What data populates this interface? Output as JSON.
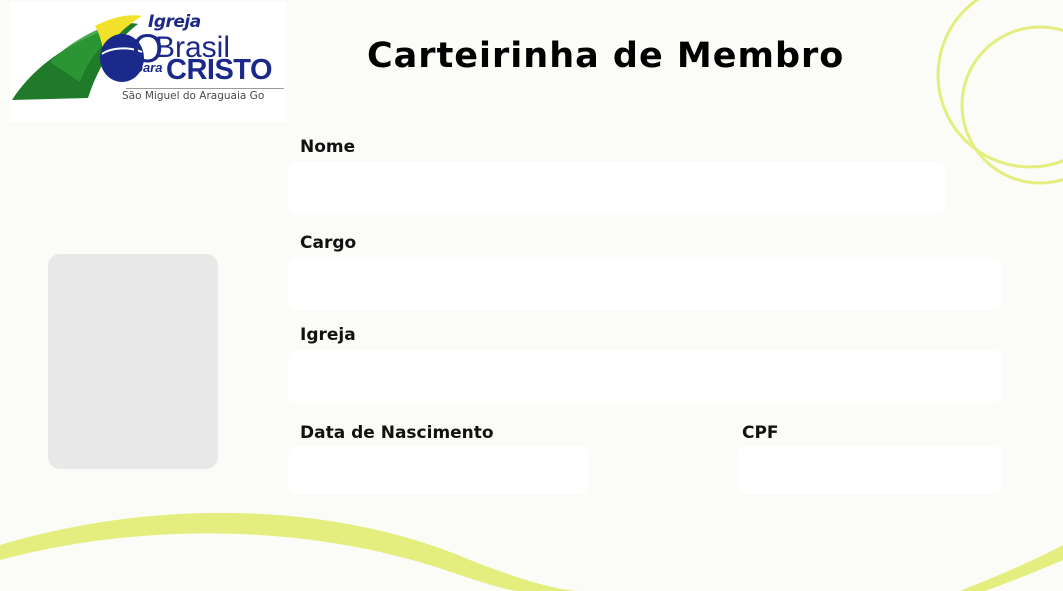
{
  "logo": {
    "igreja": "Igreja",
    "o": "O",
    "brasil": "Brasil",
    "para": "para",
    "cristo": "CRISTO",
    "city": "São Miguel do Araguaia Go"
  },
  "card": {
    "title": "Carteirinha de Membro"
  },
  "fields": {
    "nome": {
      "label": "Nome",
      "value": ""
    },
    "cargo": {
      "label": "Cargo",
      "value": ""
    },
    "igreja": {
      "label": "Igreja",
      "value": ""
    },
    "nascimento": {
      "label": "Data de Nascimento",
      "value": ""
    },
    "cpf": {
      "label": "CPF",
      "value": ""
    }
  },
  "colors": {
    "background": "#fbfbf8",
    "accent": "#e3ee7e",
    "logo_blue": "#1b2a8a",
    "logo_green": "#1f7a2a",
    "logo_yellow": "#f2e12a",
    "photo_placeholder": "#e8e8e8",
    "field_bg": "#ffffff"
  }
}
